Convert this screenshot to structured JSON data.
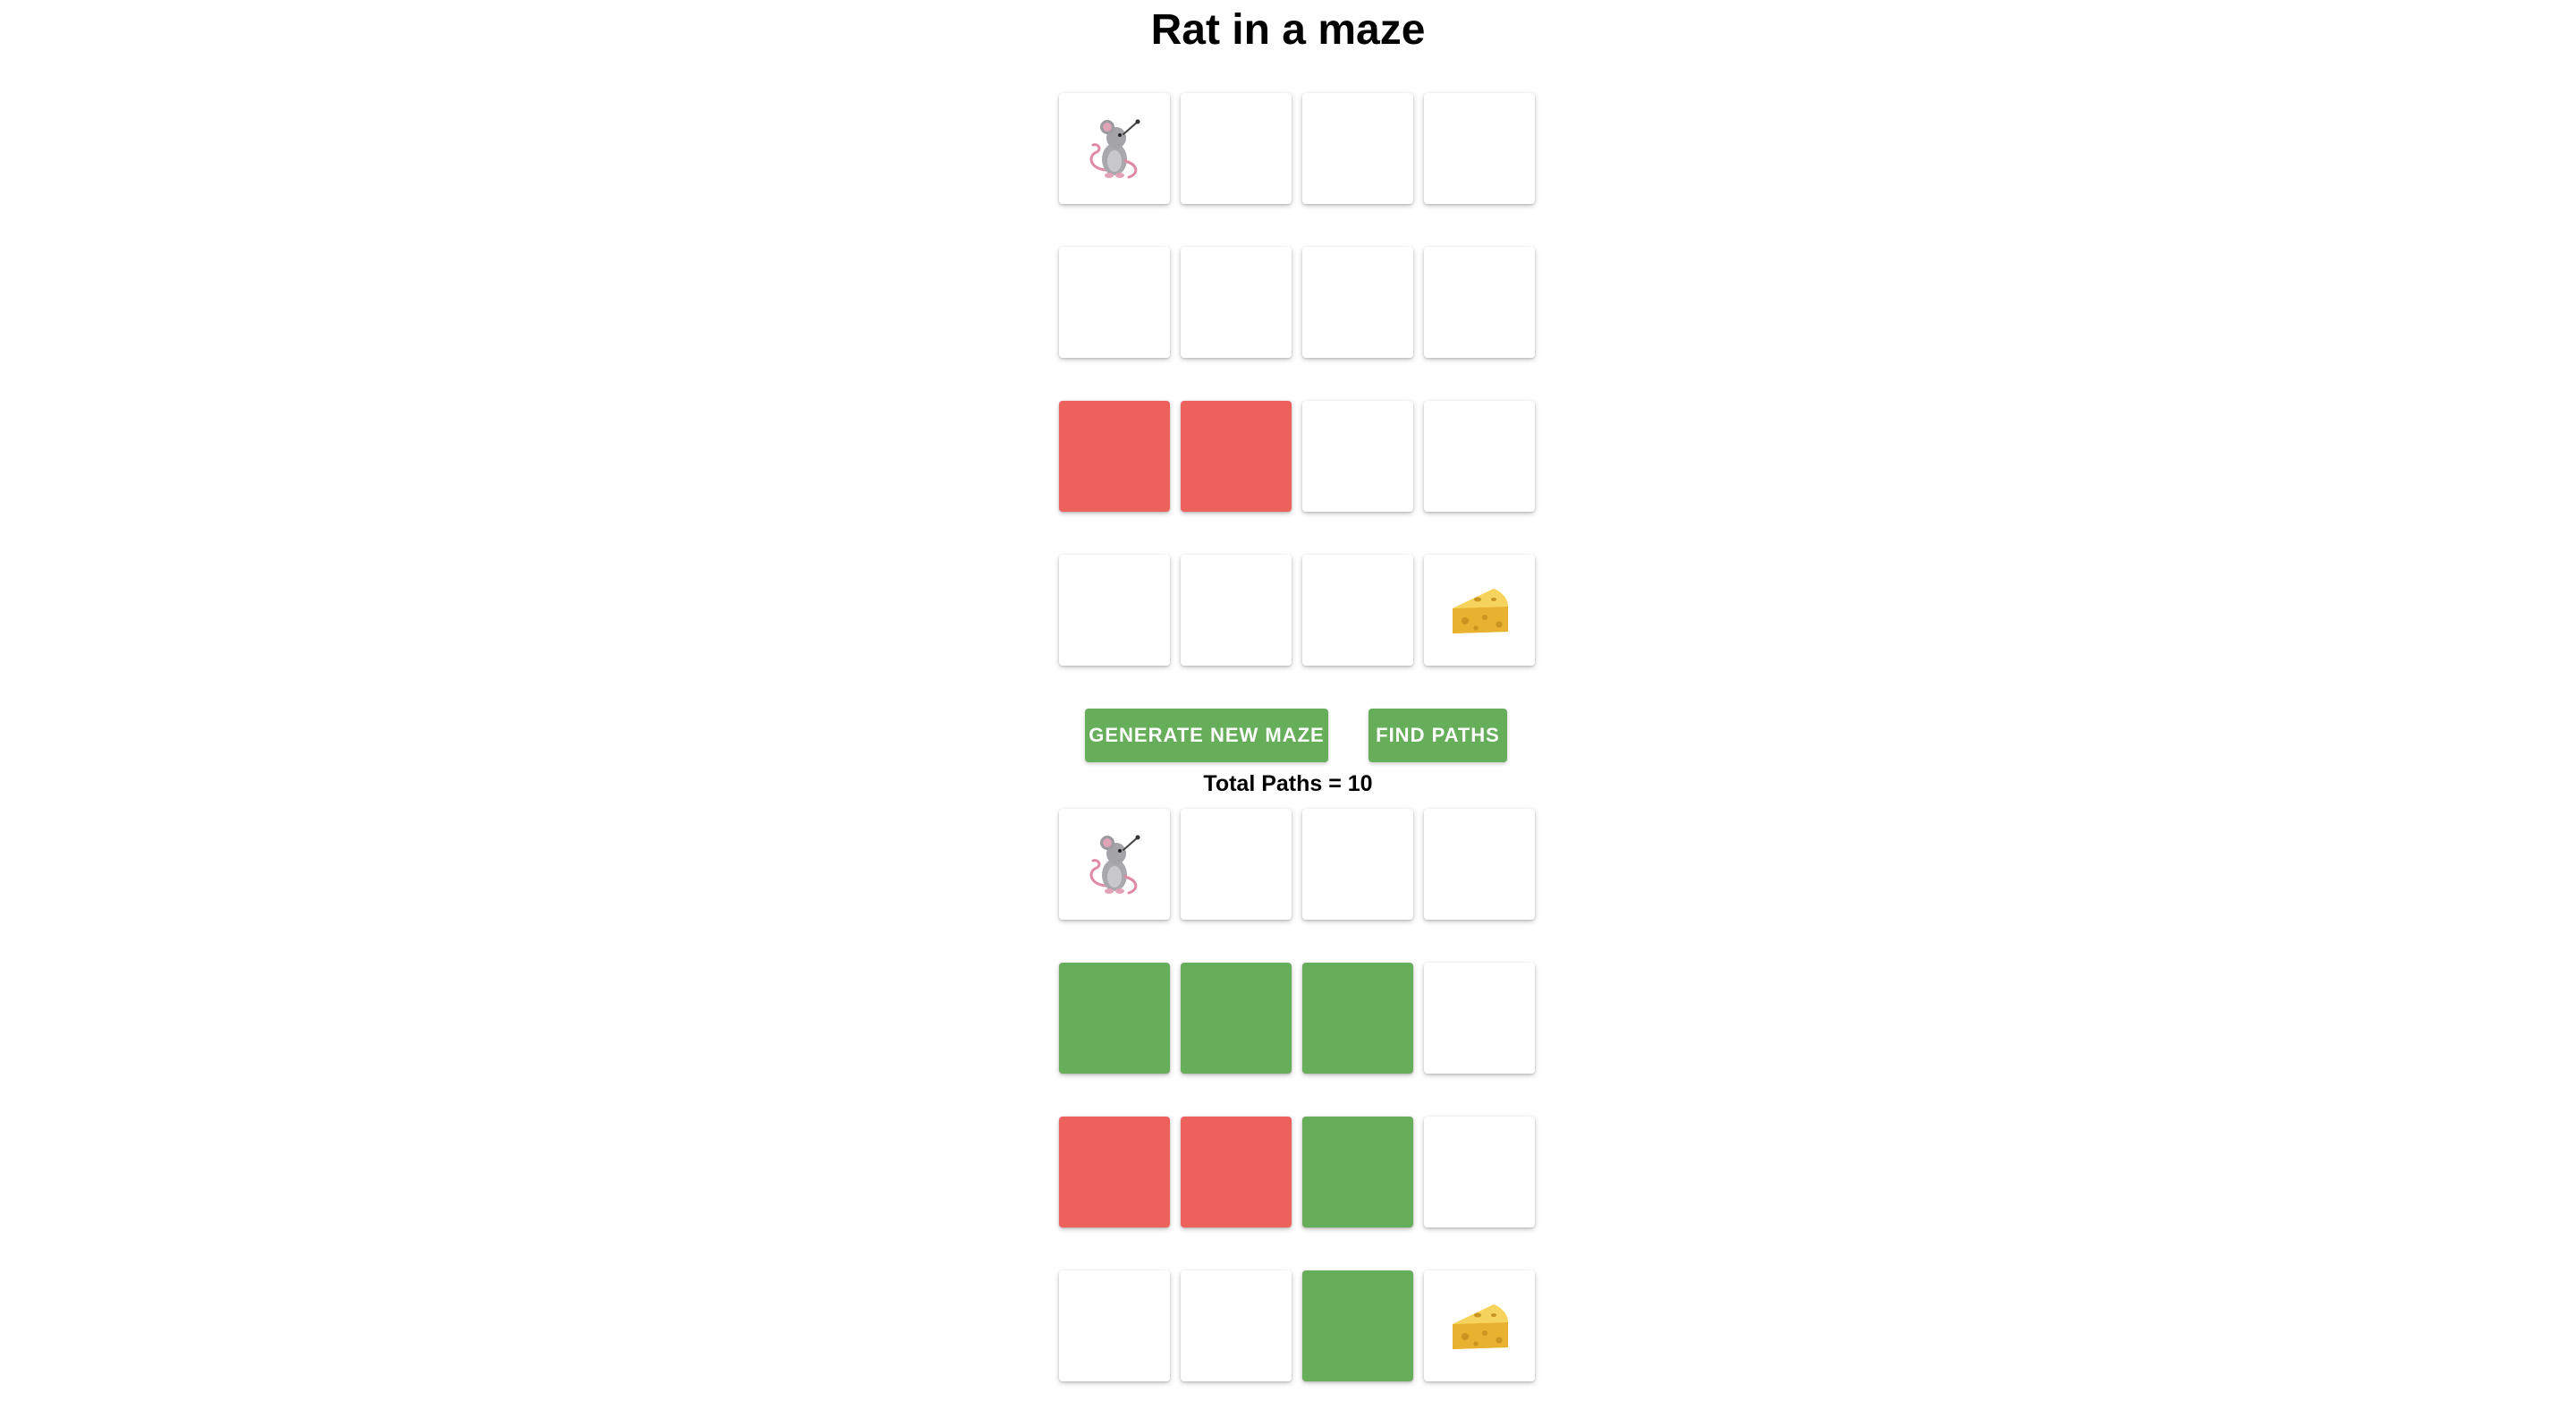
{
  "page": {
    "title": "Rat in a maze"
  },
  "controls": {
    "generate_label": "GENERATE NEW MAZE",
    "find_label": "FIND PATHS",
    "total_paths_text": "Total Paths = 10"
  },
  "colors": {
    "blocked": "#ec615b",
    "path": "#67ae5b",
    "empty": "#ffffff",
    "button": "#67ae5b"
  },
  "maze_input": {
    "rows": [
      [
        "rat",
        "empty",
        "empty",
        "empty"
      ],
      [
        "empty",
        "empty",
        "empty",
        "empty"
      ],
      [
        "blocked",
        "blocked",
        "empty",
        "empty"
      ],
      [
        "empty",
        "empty",
        "empty",
        "cheese"
      ]
    ]
  },
  "maze_solution": {
    "rows": [
      [
        "rat",
        "empty",
        "empty",
        "empty"
      ],
      [
        "path",
        "path",
        "path",
        "empty"
      ],
      [
        "blocked",
        "blocked",
        "path",
        "empty"
      ],
      [
        "empty",
        "empty",
        "path",
        "cheese"
      ]
    ]
  }
}
